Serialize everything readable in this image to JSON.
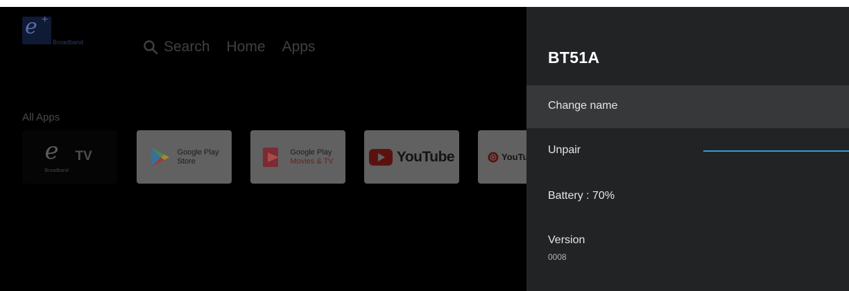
{
  "home": {
    "brand_logo": {
      "letter": "e",
      "plus": "+",
      "tagline": "Broadband"
    },
    "nav": {
      "search_label": "Search",
      "home_label": "Home",
      "apps_label": "Apps"
    },
    "all_apps_label": "All Apps",
    "apps": [
      {
        "name": "eTV",
        "logo_tv": "TV",
        "logo_tagline": "Broadband"
      },
      {
        "name": "Google Play Store",
        "line1": "Google Play",
        "line2": "Store"
      },
      {
        "name": "Google Play Movies & TV",
        "line1": "Google Play",
        "line2": "Movies & TV"
      },
      {
        "name": "YouTube",
        "wordmark": "YouTube"
      },
      {
        "name": "YouTube Music",
        "wordmark": "YouTu"
      }
    ]
  },
  "panel": {
    "title": "BT51A",
    "items": [
      {
        "label": "Change name",
        "focused": true
      },
      {
        "label": "Unpair",
        "progress_visible": true
      },
      {
        "label": "Battery : 70%"
      },
      {
        "label": "Version",
        "value": "0008"
      }
    ]
  },
  "colors": {
    "panel_bg": "#212325",
    "focused_row_bg": "#36383a",
    "progress_accent": "#2f9fd1"
  }
}
